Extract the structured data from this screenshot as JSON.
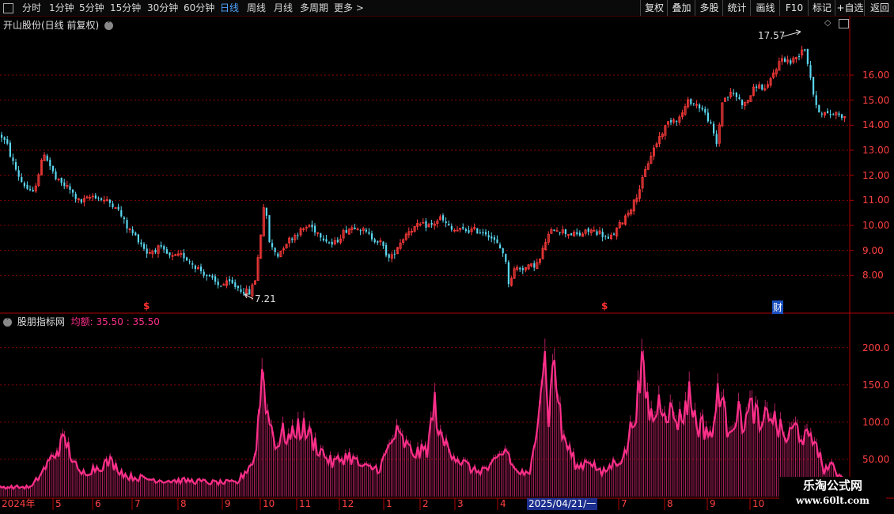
{
  "toolbar": {
    "left_items": [
      "分时",
      "1分钟",
      "5分钟",
      "15分钟",
      "30分钟",
      "60分钟",
      "日线",
      "周线",
      "月线",
      "多周期",
      "更多 >"
    ],
    "active": "日线",
    "right_items": [
      "复权",
      "叠加",
      "多股",
      "统计",
      "画线",
      "F10",
      "标记",
      "+自选",
      "返回"
    ]
  },
  "main_chart": {
    "title": "开山股份(日线 前复权)",
    "price_ticks": [
      "16.00",
      "15.00",
      "14.00",
      "13.00",
      "12.00",
      "11.00",
      "10.00",
      "9.00",
      "8.00"
    ],
    "high_label": "17.57",
    "low_label": "7.21",
    "markers": [
      "$",
      "$",
      "财"
    ]
  },
  "indicator": {
    "name": "股朋指标网",
    "value_label": "均额: 35.50 : 35.50",
    "ticks": [
      "200.0",
      "150.0",
      "100.0",
      "50.00"
    ]
  },
  "x_axis": {
    "labels": [
      "2024年",
      "5",
      "6",
      "7",
      "8",
      "9",
      "10",
      "11",
      "12",
      "1",
      "2",
      "3",
      "4",
      "2025/04/21/一",
      "7",
      "8",
      "9",
      "10"
    ]
  },
  "watermark": {
    "line1": "乐淘公式网",
    "line2": "www.60lt.com"
  },
  "colors": {
    "up": "#ff3b3b",
    "down": "#5ad7f0",
    "indicator": "#ff2f8a",
    "grid": "#8b0000",
    "axis": "#b00000",
    "active_tab": "#4fa3ff"
  },
  "chart_data": {
    "type": "candlestick",
    "price_ylim": [
      7.0,
      17.8
    ],
    "volume_ylim": [
      0,
      240
    ],
    "anchors": [
      [
        0,
        13.6
      ],
      [
        8,
        13.2
      ],
      [
        14,
        12.6
      ],
      [
        25,
        11.8
      ],
      [
        40,
        11.2
      ],
      [
        55,
        12.9
      ],
      [
        70,
        11.8
      ],
      [
        85,
        11.5
      ],
      [
        100,
        10.9
      ],
      [
        118,
        11.2
      ],
      [
        130,
        11.0
      ],
      [
        145,
        10.8
      ],
      [
        160,
        9.9
      ],
      [
        175,
        9.4
      ],
      [
        185,
        8.9
      ],
      [
        200,
        9.1
      ],
      [
        215,
        8.7
      ],
      [
        230,
        8.8
      ],
      [
        245,
        8.4
      ],
      [
        260,
        8.0
      ],
      [
        275,
        7.6
      ],
      [
        290,
        7.7
      ],
      [
        305,
        7.4
      ],
      [
        315,
        7.3
      ],
      [
        322,
        7.9
      ],
      [
        328,
        9.5
      ],
      [
        333,
        11.0
      ],
      [
        340,
        9.2
      ],
      [
        350,
        8.8
      ],
      [
        360,
        9.3
      ],
      [
        375,
        9.7
      ],
      [
        390,
        10.0
      ],
      [
        405,
        9.6
      ],
      [
        420,
        9.2
      ],
      [
        435,
        9.8
      ],
      [
        450,
        10.0
      ],
      [
        465,
        9.6
      ],
      [
        480,
        9.3
      ],
      [
        492,
        8.6
      ],
      [
        500,
        9.1
      ],
      [
        515,
        9.8
      ],
      [
        530,
        10.0
      ],
      [
        545,
        10.0
      ],
      [
        555,
        10.3
      ],
      [
        570,
        9.8
      ],
      [
        585,
        9.8
      ],
      [
        600,
        9.8
      ],
      [
        615,
        9.7
      ],
      [
        628,
        9.2
      ],
      [
        636,
        8.9
      ],
      [
        642,
        7.7
      ],
      [
        650,
        8.3
      ],
      [
        665,
        8.3
      ],
      [
        680,
        8.5
      ],
      [
        690,
        9.5
      ],
      [
        700,
        9.9
      ],
      [
        715,
        9.7
      ],
      [
        730,
        9.6
      ],
      [
        745,
        9.8
      ],
      [
        758,
        9.7
      ],
      [
        768,
        9.4
      ],
      [
        778,
        9.8
      ],
      [
        788,
        10.3
      ],
      [
        800,
        10.9
      ],
      [
        810,
        11.7
      ],
      [
        820,
        12.7
      ],
      [
        832,
        13.5
      ],
      [
        845,
        14.2
      ],
      [
        858,
        14.3
      ],
      [
        870,
        15.0
      ],
      [
        885,
        14.7
      ],
      [
        895,
        14.2
      ],
      [
        905,
        13.2
      ],
      [
        912,
        15.0
      ],
      [
        925,
        15.3
      ],
      [
        940,
        14.8
      ],
      [
        955,
        15.6
      ],
      [
        968,
        15.4
      ],
      [
        978,
        16.2
      ],
      [
        988,
        16.7
      ],
      [
        998,
        16.5
      ],
      [
        1008,
        16.8
      ],
      [
        1015,
        17.2
      ],
      [
        1022,
        16.2
      ],
      [
        1030,
        14.7
      ],
      [
        1045,
        14.4
      ],
      [
        1058,
        14.5
      ],
      [
        1067,
        14.3
      ]
    ],
    "volume_peaks": [
      [
        40,
        15
      ],
      [
        65,
        60
      ],
      [
        82,
        90
      ],
      [
        100,
        35
      ],
      [
        120,
        45
      ],
      [
        140,
        55
      ],
      [
        160,
        32
      ],
      [
        185,
        28
      ],
      [
        210,
        25
      ],
      [
        240,
        25
      ],
      [
        270,
        22
      ],
      [
        300,
        22
      ],
      [
        322,
        60
      ],
      [
        328,
        140
      ],
      [
        332,
        208
      ],
      [
        338,
        130
      ],
      [
        350,
        80
      ],
      [
        358,
        100
      ],
      [
        368,
        90
      ],
      [
        375,
        110
      ],
      [
        386,
        105
      ],
      [
        400,
        80
      ],
      [
        420,
        52
      ],
      [
        440,
        65
      ],
      [
        460,
        45
      ],
      [
        480,
        45
      ],
      [
        500,
        100
      ],
      [
        510,
        85
      ],
      [
        520,
        70
      ],
      [
        530,
        68
      ],
      [
        540,
        75
      ],
      [
        550,
        148
      ],
      [
        556,
        90
      ],
      [
        566,
        80
      ],
      [
        580,
        58
      ],
      [
        600,
        40
      ],
      [
        620,
        45
      ],
      [
        640,
        75
      ],
      [
        650,
        42
      ],
      [
        670,
        32
      ],
      [
        688,
        228
      ],
      [
        694,
        120
      ],
      [
        700,
        228
      ],
      [
        710,
        100
      ],
      [
        730,
        45
      ],
      [
        745,
        60
      ],
      [
        760,
        35
      ],
      [
        778,
        55
      ],
      [
        790,
        65
      ],
      [
        806,
        155
      ],
      [
        812,
        200
      ],
      [
        818,
        150
      ],
      [
        825,
        120
      ],
      [
        835,
        155
      ],
      [
        848,
        130
      ],
      [
        860,
        120
      ],
      [
        872,
        162
      ],
      [
        880,
        115
      ],
      [
        892,
        108
      ],
      [
        902,
        95
      ],
      [
        908,
        185
      ],
      [
        918,
        110
      ],
      [
        932,
        130
      ],
      [
        942,
        118
      ],
      [
        952,
        145
      ],
      [
        962,
        98
      ],
      [
        972,
        140
      ],
      [
        982,
        110
      ],
      [
        995,
        90
      ],
      [
        1005,
        110
      ],
      [
        1015,
        95
      ],
      [
        1025,
        85
      ],
      [
        1032,
        90
      ],
      [
        1040,
        40
      ],
      [
        1048,
        50
      ],
      [
        1060,
        35
      ]
    ],
    "x_tick_positions": [
      2,
      70,
      120,
      170,
      228,
      284,
      332,
      378,
      432,
      488,
      534,
      578,
      632,
      666,
      785,
      843,
      897,
      951
    ]
  }
}
